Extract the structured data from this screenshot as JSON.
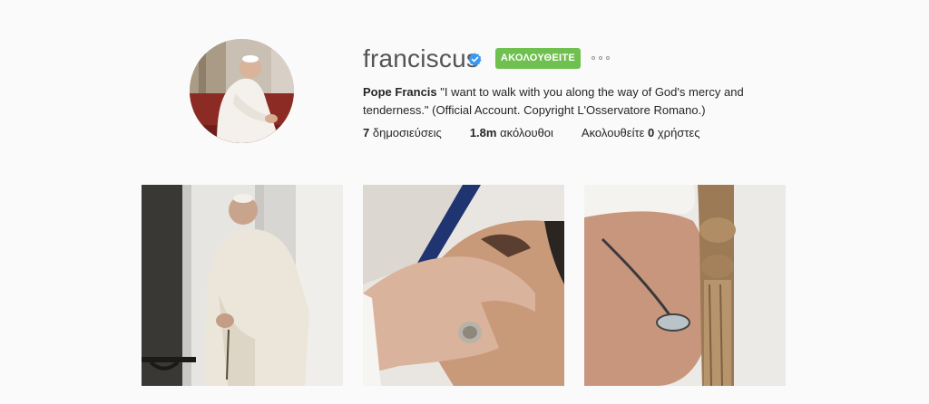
{
  "profile": {
    "username": "franciscus",
    "verified": true,
    "follow_label": "ΑΚΟΛΟΥΘΕΙΤΕ",
    "more_icon": "ellipsis-icon",
    "bio_name": "Pope Francis",
    "bio_text": " \"I want to walk with you along the way of God's mercy and tenderness.\" (Official Account. Copyright L'Osservatore Romano.)",
    "posts_count": "7",
    "posts_label": " δημοσιεύσεις",
    "followers_count": "1.8m",
    "followers_label": " ακόλουθοι",
    "following_prefix": "Ακολουθείτε ",
    "following_count": "0",
    "following_label": " χρήστες"
  },
  "colors": {
    "follow_button": "#70c050",
    "verified_badge": "#3897f0",
    "background": "#fafafa"
  },
  "posts": [
    {
      "icon": "photo-pope-praying-window"
    },
    {
      "icon": "photo-hand-on-face"
    },
    {
      "icon": "photo-pope-forehead-staff"
    }
  ]
}
